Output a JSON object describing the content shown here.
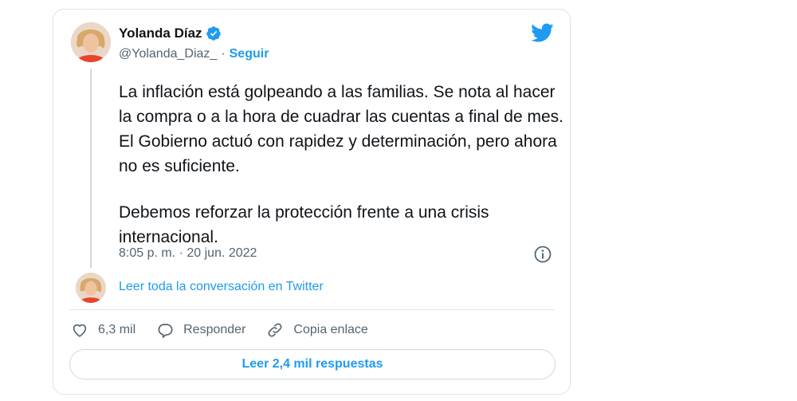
{
  "author": {
    "name": "Yolanda Díaz",
    "handle": "@Yolanda_Diaz_",
    "separator": "·",
    "follow_label": "Seguir"
  },
  "tweet": {
    "paragraphs": [
      "La inflación está golpeando a las familias. Se nota al hacer la compra o a la hora de cuadrar las cuentas a final de mes. El Gobierno actuó con rapidez y determinación, pero ahora no es suficiente.",
      "Debemos reforzar la protección frente a una crisis internacional."
    ],
    "timestamp": "8:05 p. m. · 20 jun. 2022"
  },
  "conversation_link": "Leer toda la conversación en Twitter",
  "actions": {
    "likes_count": "6,3 mil",
    "reply_label": "Responder",
    "copy_link_label": "Copia enlace"
  },
  "read_replies_label": "Leer 2,4 mil respuestas",
  "colors": {
    "accent": "#1d9bf0",
    "text": "#0f1419",
    "secondary": "#536471",
    "border": "#dde3e8"
  },
  "icons": [
    "verified-badge-icon",
    "twitter-bird-icon",
    "info-icon",
    "heart-icon",
    "reply-icon",
    "link-icon"
  ]
}
